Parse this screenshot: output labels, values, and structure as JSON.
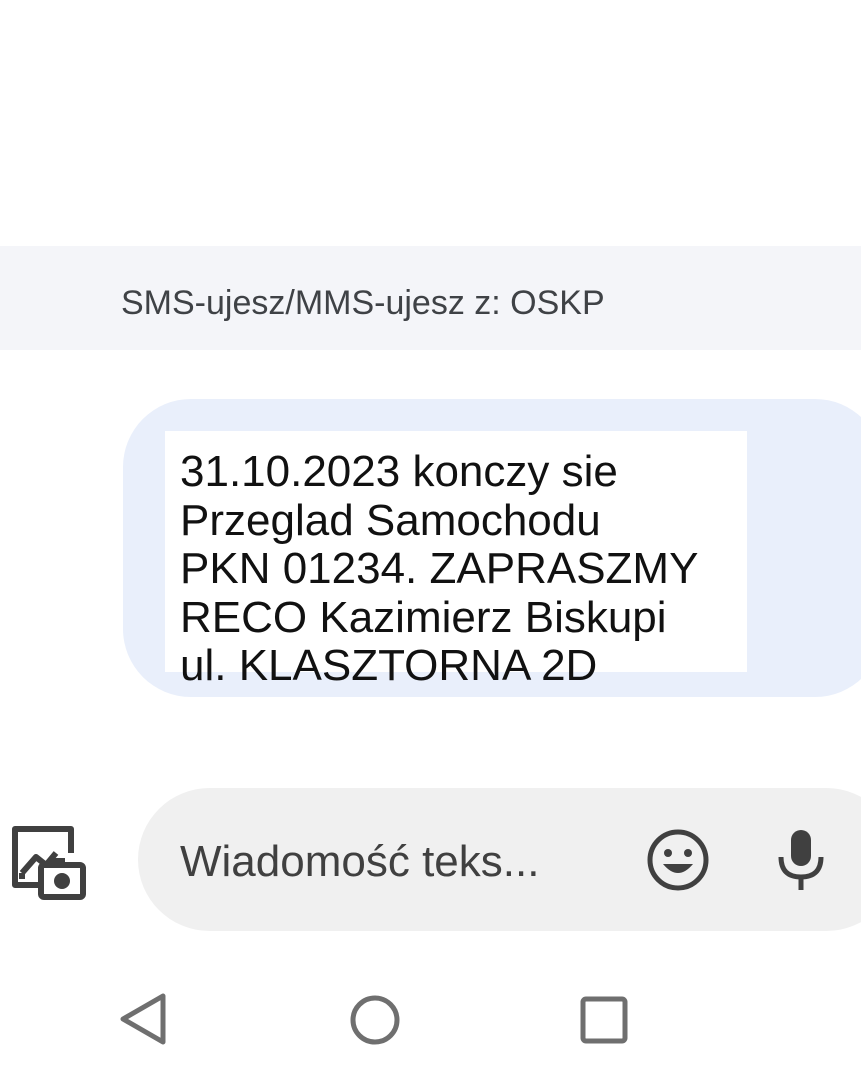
{
  "thread": {
    "sender_info": "SMS-ujesz/MMS-ujesz z: OSKP"
  },
  "message": {
    "lines": [
      "31.10.2023 konczy sie",
      "Przeglad Samochodu",
      "PKN 01234. ZAPRASZMY",
      "RECO Kazimierz Biskupi",
      "ul. KLASZTORNA 2D"
    ],
    "bubble_color": "#e9effb"
  },
  "compose": {
    "placeholder": "Wiadomość teks...",
    "value": "",
    "attach_icon": "add-photo-camera-icon",
    "emoji_icon": "emoji-icon",
    "mic_icon": "microphone-icon"
  },
  "navigation": {
    "back_icon": "back-triangle-icon",
    "home_icon": "home-circle-icon",
    "recents_icon": "recents-square-icon"
  },
  "colors": {
    "banner_bg": "#f4f5f9",
    "compose_bg": "#f0f0f0",
    "icon": "#404040",
    "nav_icon": "#6f6f6f"
  }
}
